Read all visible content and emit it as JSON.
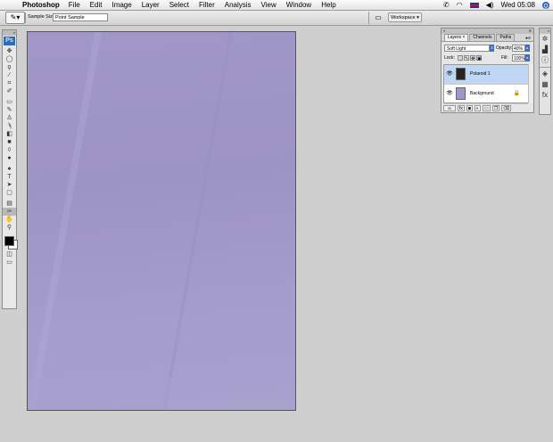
{
  "menubar": {
    "apple_icon": "apple-logo-icon",
    "app_name": "Photoshop",
    "menus": [
      "File",
      "Edit",
      "Image",
      "Layer",
      "Select",
      "Filter",
      "Analysis",
      "View",
      "Window",
      "Help"
    ],
    "clock": "Wed 05:08",
    "status_icons": [
      "phone-icon",
      "wifi-icon",
      "flag-icon",
      "volume-icon",
      "spotlight-icon"
    ]
  },
  "options": {
    "sample_size_label": "Sample Size:",
    "sample_size_value": "Point Sample",
    "workspace_label": "Workspace"
  },
  "toolbox": {
    "logo_text": "Ps",
    "tools": [
      "move-tool-icon",
      "marquee-tool-icon",
      "lasso-tool-icon",
      "magic-wand-icon",
      "crop-tool-icon",
      "slice-tool-icon",
      "healing-brush-icon",
      "brush-tool-icon",
      "clone-stamp-icon",
      "history-brush-icon",
      "eraser-tool-icon",
      "gradient-tool-icon",
      "blur-tool-icon",
      "dodge-tool-icon",
      "pen-tool-icon",
      "type-tool-icon",
      "path-selection-icon",
      "shape-tool-icon",
      "notes-tool-icon",
      "eyedropper-tool-icon",
      "hand-tool-icon",
      "zoom-tool-icon"
    ],
    "selected_tool": "eyedropper-tool-icon",
    "foreground_color": "#000000",
    "background_color": "#ffffff"
  },
  "document": {
    "fill_color": "#a097c8"
  },
  "layers_panel": {
    "tabs": [
      "Layers",
      "Channels",
      "Paths"
    ],
    "active_tab": "Layers",
    "blend_mode": "Soft Light",
    "opacity_label": "Opacity:",
    "opacity_value": "40%",
    "lock_label": "Lock:",
    "fill_label": "Fill:",
    "fill_value": "100%",
    "layers": [
      {
        "name": "Polaroid 1",
        "thumb_color": "#2a2420",
        "active": true
      },
      {
        "name": "Background",
        "thumb_color": "#a097c8",
        "active": false
      }
    ],
    "footer_buttons": [
      "link-layers-icon",
      "fx-icon",
      "mask-icon",
      "adjustment-icon",
      "group-icon",
      "new-layer-icon",
      "trash-icon"
    ]
  },
  "dock": {
    "icons": [
      "navigator-icon",
      "histogram-icon",
      "info-icon",
      "color-icon",
      "swatches-icon",
      "styles-icon"
    ]
  }
}
